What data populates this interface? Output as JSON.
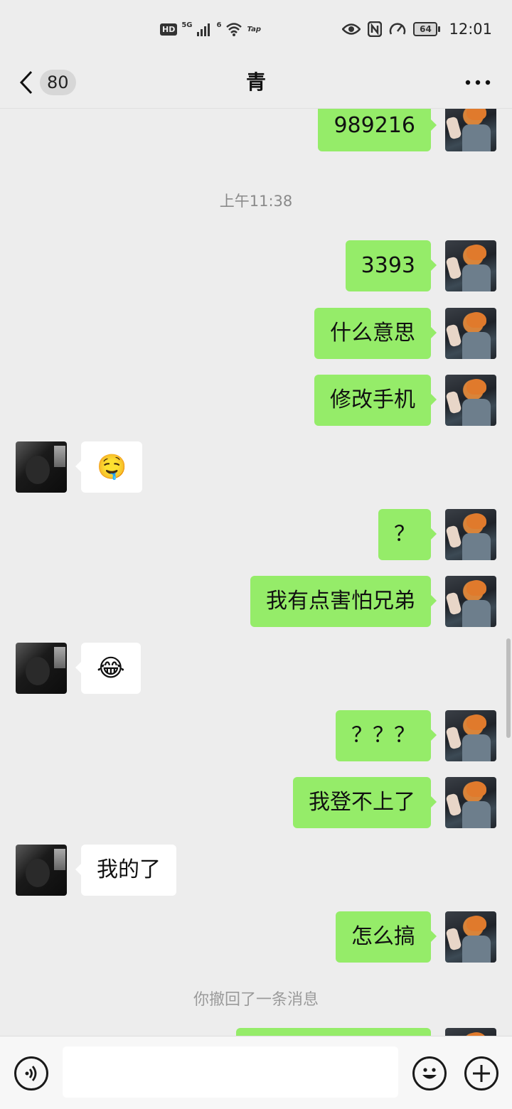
{
  "status_bar": {
    "hd": "HD",
    "net_5g": "5G",
    "wifi_tag": "6",
    "app_tag": "Tap",
    "battery": "64",
    "time": "12:01"
  },
  "header": {
    "unread_count": "80",
    "title": "青"
  },
  "messages": [
    {
      "side": "right",
      "text": "989216"
    },
    {
      "type": "time",
      "text": "上午11:38"
    },
    {
      "side": "right",
      "text": "3393"
    },
    {
      "side": "right",
      "text": "什么意思"
    },
    {
      "side": "right",
      "text": "修改手机"
    },
    {
      "side": "left",
      "text": "🤤"
    },
    {
      "side": "right",
      "text": "？"
    },
    {
      "side": "right",
      "text": "我有点害怕兄弟"
    },
    {
      "side": "left",
      "text": "😂"
    },
    {
      "side": "right",
      "text": "？？？"
    },
    {
      "side": "right",
      "text": "我登不上了"
    },
    {
      "side": "left",
      "text": "我的了"
    },
    {
      "side": "right",
      "text": "怎么搞"
    },
    {
      "type": "system",
      "text": "你撤回了一条消息"
    }
  ],
  "input": {
    "placeholder": ""
  }
}
